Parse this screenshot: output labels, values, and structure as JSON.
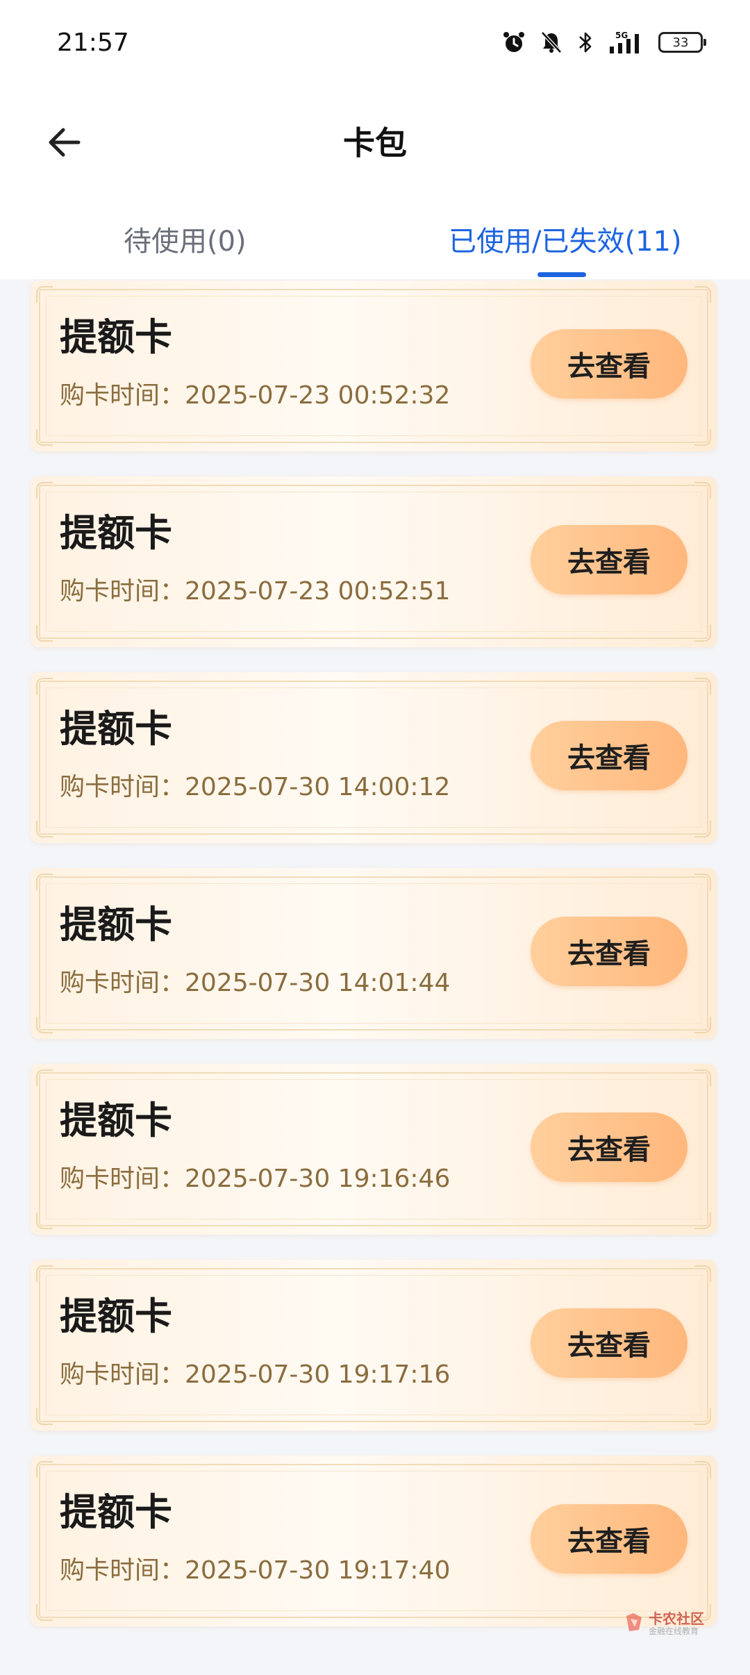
{
  "status_bar": {
    "time": "21:57",
    "battery": "33",
    "network": "5G",
    "icons": [
      "alarm-icon",
      "mute-bell-icon",
      "bluetooth-icon",
      "signal-5g-icon",
      "battery-icon"
    ]
  },
  "header": {
    "title": "卡包",
    "back_icon": "arrow-left-icon"
  },
  "tabs": [
    {
      "label": "待使用(0)",
      "active": false
    },
    {
      "label": "已使用/已失效(11)",
      "active": true
    }
  ],
  "colors": {
    "accent": "#1d64e0",
    "button": "#ffb77c",
    "card_bg": "#fff2e2"
  },
  "cards": [
    {
      "title": "提额卡",
      "time_label": "购卡时间：",
      "time": "2025-07-23 00:52:32",
      "button": "去查看"
    },
    {
      "title": "提额卡",
      "time_label": "购卡时间：",
      "time": "2025-07-23 00:52:51",
      "button": "去查看"
    },
    {
      "title": "提额卡",
      "time_label": "购卡时间：",
      "time": "2025-07-30 14:00:12",
      "button": "去查看"
    },
    {
      "title": "提额卡",
      "time_label": "购卡时间：",
      "time": "2025-07-30 14:01:44",
      "button": "去查看"
    },
    {
      "title": "提额卡",
      "time_label": "购卡时间：",
      "time": "2025-07-30 19:16:46",
      "button": "去查看"
    },
    {
      "title": "提额卡",
      "time_label": "购卡时间：",
      "time": "2025-07-30 19:17:16",
      "button": "去查看"
    },
    {
      "title": "提额卡",
      "time_label": "购卡时间：",
      "time": "2025-07-30 19:17:40",
      "button": "去查看"
    }
  ],
  "watermark": {
    "text": "卡农社区",
    "sub": "金融在线教育"
  }
}
